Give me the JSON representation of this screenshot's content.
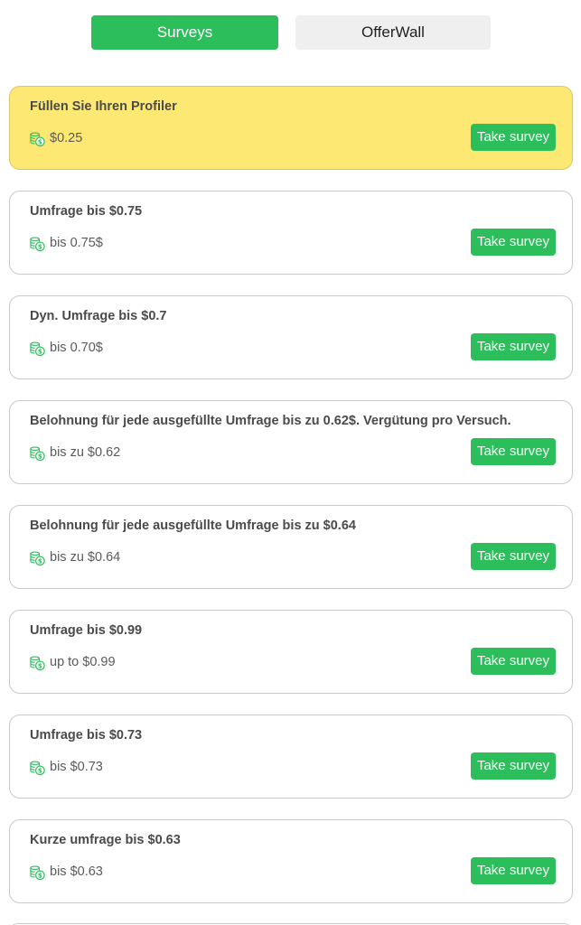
{
  "tabs": {
    "surveys_label": "Surveys",
    "offerwall_label": "OfferWall"
  },
  "colors": {
    "accent": "#2dbe5c",
    "highlight": "#fde874",
    "tab_inactive": "#efefef"
  },
  "surveys": [
    {
      "title": "Füllen Sie Ihren Profiler",
      "reward": "$0.25",
      "button": "Take survey",
      "highlighted": true
    },
    {
      "title": "Umfrage bis $0.75",
      "reward": "bis 0.75$",
      "button": "Take survey",
      "highlighted": false
    },
    {
      "title": "Dyn. Umfrage bis $0.7",
      "reward": "bis 0.70$",
      "button": "Take survey",
      "highlighted": false
    },
    {
      "title": "Belohnung für jede ausgefüllte Umfrage bis zu 0.62$. Vergütung pro Versuch.",
      "reward": "bis zu $0.62",
      "button": "Take survey",
      "highlighted": false
    },
    {
      "title": "Belohnung für jede ausgefüllte Umfrage bis zu $0.64",
      "reward": "bis zu $0.64",
      "button": "Take survey",
      "highlighted": false
    },
    {
      "title": "Umfrage bis $0.99",
      "reward": "up to $0.99",
      "button": "Take survey",
      "highlighted": false
    },
    {
      "title": "Umfrage bis $0.73",
      "reward": "bis $0.73",
      "button": "Take survey",
      "highlighted": false
    },
    {
      "title": "Kurze umfrage bis $0.63",
      "reward": "bis $0.63",
      "button": "Take survey",
      "highlighted": false
    }
  ],
  "icons": {
    "reward_icon": "money-coins-icon"
  }
}
